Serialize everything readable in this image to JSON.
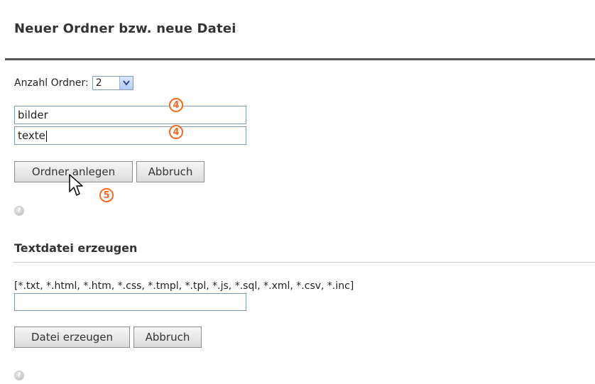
{
  "header": {
    "title": "Neuer Ordner bzw. neue Datei"
  },
  "folder_form": {
    "count_label": "Anzahl Ordner:",
    "count_value": "2",
    "folder_names": [
      "bilder",
      "texte"
    ],
    "create_button": "Ordner anlegen",
    "cancel_button": "Abbruch",
    "help_glyph": "?"
  },
  "annotations": {
    "input1_step": "4",
    "input2_step": "4",
    "button_step": "5",
    "color": "#f26b22"
  },
  "textfile_form": {
    "title": "Textdatei erzeugen",
    "extensions": "[*.txt, *.html, *.htm, *.css, *.tmpl, *.tpl, *.js, *.sql, *.xml, *.csv, *.inc]",
    "filename_value": "",
    "create_button": "Datei erzeugen",
    "cancel_button": "Abbruch",
    "help_glyph": "?"
  },
  "icons": [
    "chevron-down-icon",
    "help-icon",
    "mouse-pointer-icon"
  ]
}
